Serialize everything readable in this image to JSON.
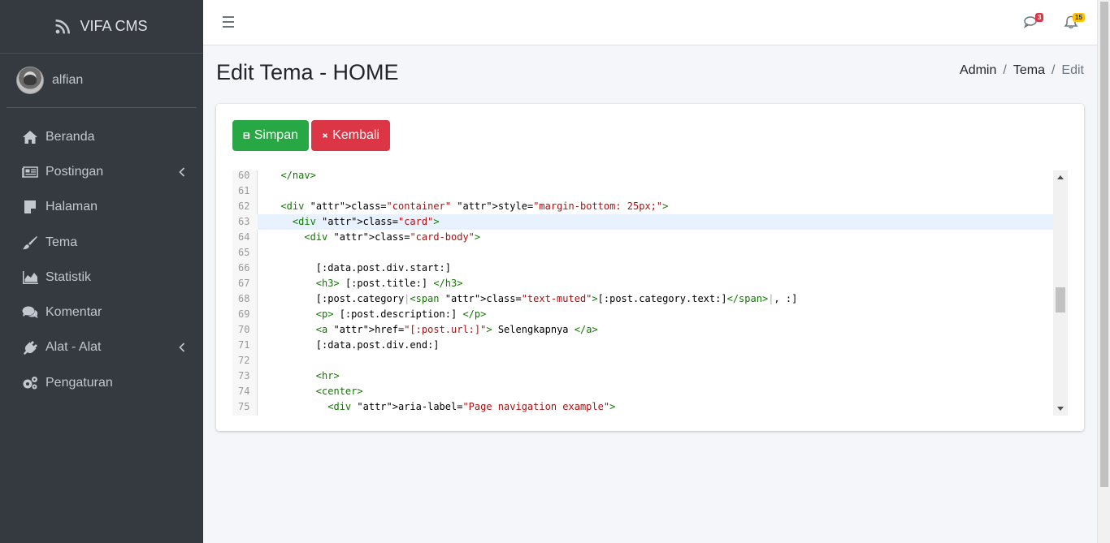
{
  "brand": {
    "name": "VIFA CMS",
    "icon": "rss-icon"
  },
  "user": {
    "name": "alfian"
  },
  "sidebar": {
    "items": [
      {
        "label": "Beranda",
        "icon": "home-icon"
      },
      {
        "label": "Postingan",
        "icon": "newspaper-icon",
        "has_children": true
      },
      {
        "label": "Halaman",
        "icon": "sticky-note-icon"
      },
      {
        "label": "Tema",
        "icon": "paint-brush-icon"
      },
      {
        "label": "Statistik",
        "icon": "area-chart-icon"
      },
      {
        "label": "Komentar",
        "icon": "comments-icon"
      },
      {
        "label": "Alat - Alat",
        "icon": "plug-icon",
        "has_children": true
      },
      {
        "label": "Pengaturan",
        "icon": "cogs-icon"
      }
    ]
  },
  "navbar": {
    "messages_count": "3",
    "notifications_count": "15",
    "colors": {
      "messages_badge": "#dc3545",
      "notifications_badge": "#ffc107"
    }
  },
  "header": {
    "title": "Edit Tema - HOME",
    "breadcrumb": [
      "Admin",
      "Tema",
      "Edit"
    ]
  },
  "actions": {
    "save_label": "Simpan",
    "back_label": "Kembali"
  },
  "colors": {
    "sidebar_bg": "#343a40",
    "save": "#28a745",
    "back": "#dc3545"
  },
  "editor": {
    "active_line": 63,
    "lines": [
      {
        "n": "60",
        "text": "  </nav>"
      },
      {
        "n": "61",
        "text": ""
      },
      {
        "n": "62",
        "text": "  <div class=\"container\" style=\"margin-bottom: 25px;\">"
      },
      {
        "n": "63",
        "text": "    <div class=\"card\">"
      },
      {
        "n": "64",
        "text": "      <div class=\"card-body\">"
      },
      {
        "n": "65",
        "text": ""
      },
      {
        "n": "66",
        "text": "        [:data.post.div.start:]"
      },
      {
        "n": "67",
        "text": "        <h3> [:post.title:] </h3>"
      },
      {
        "n": "68",
        "text": "        [:post.category|<span class=\"text-muted\">[:post.category.text:]</span>|, :]"
      },
      {
        "n": "69",
        "text": "        <p> [:post.description:] </p>"
      },
      {
        "n": "70",
        "text": "        <a href=\"[:post.url:]\"> Selengkapnya </a>"
      },
      {
        "n": "71",
        "text": "        [:data.post.div.end:]"
      },
      {
        "n": "72",
        "text": ""
      },
      {
        "n": "73",
        "text": "        <hr>"
      },
      {
        "n": "74",
        "text": "        <center>"
      },
      {
        "n": "75",
        "text": "          <div aria-label=\"Page navigation example\">"
      }
    ]
  }
}
